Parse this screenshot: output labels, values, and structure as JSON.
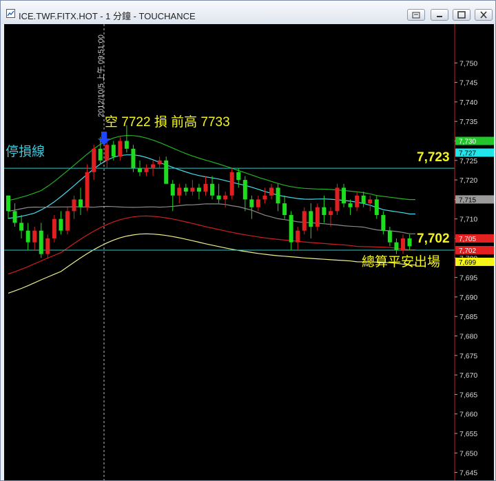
{
  "window": {
    "title": "ICE.TWF.FITX.HOT - 1 分鐘 - TOUCHANCE"
  },
  "chart_data": {
    "type": "candlestick",
    "symbol": "ICE.TWF.FITX.HOT",
    "interval": "1 分鐘",
    "ylim": [
      7642,
      7756
    ],
    "y_ticks": [
      "7,750",
      "7,745",
      "7,740",
      "7,735",
      "7,730",
      "7,725",
      "7,720",
      "7,715",
      "7,710",
      "7,705",
      "7,700",
      "7,695",
      "7,690",
      "7,685",
      "7,680",
      "7,675",
      "7,670",
      "7,665",
      "7,660",
      "7,655",
      "7,650",
      "7,645"
    ],
    "timestamp_label": "2012/10/5 上午 09:51:00",
    "annotations": {
      "entry": "空 7722 損 前高 7733",
      "stop_line_label": "停損線",
      "stop_level_text": "7,723",
      "exit_level_text": "7,702",
      "exit_note": "總算平安出場"
    },
    "reference_lines": [
      7723,
      7702
    ],
    "price_tags": [
      {
        "text": "7,730",
        "value": 7730,
        "bg": "#22c52a",
        "fg": "#ffffff"
      },
      {
        "text": "7,727",
        "value": 7727,
        "bg": "#22e5ea",
        "fg": "#000000"
      },
      {
        "text": "7,715",
        "value": 7715,
        "bg": "#9b9b9b",
        "fg": "#000000"
      },
      {
        "text": "7,705",
        "value": 7705,
        "bg": "#e52020",
        "fg": "#ffffff"
      },
      {
        "text": "7,702",
        "value": 7702,
        "bg": "#e52020",
        "fg": "#ffffff"
      },
      {
        "text": "7,699",
        "value": 7699,
        "bg": "#f5f516",
        "fg": "#000000"
      }
    ],
    "colors": {
      "up": "#e02020",
      "down": "#1edc1e",
      "bb_upper": "#22b422",
      "ma_cyan": "#46dcf0",
      "ma_gray": "#8c8c8c",
      "bb_lower_red": "#d21e1e",
      "bb_lower_yellow": "#f0f08c",
      "ref_line": "#32c8c8",
      "annotation": "#f5f51e",
      "arrow": "#1e46ff",
      "axis_border": "#c81e1e"
    },
    "candles": [
      [
        7716,
        7716,
        7710,
        7712
      ],
      [
        7712,
        7714,
        7708,
        7709
      ],
      [
        7709,
        7711,
        7705,
        7707
      ],
      [
        7707,
        7709,
        7702,
        7704
      ],
      [
        7704,
        7708,
        7702,
        7707
      ],
      [
        7707,
        7709,
        7700,
        7701
      ],
      [
        7701,
        7706,
        7700,
        7705
      ],
      [
        7705,
        7711,
        7704,
        7710
      ],
      [
        7710,
        7712,
        7706,
        7707
      ],
      [
        7707,
        7713,
        7706,
        7712
      ],
      [
        7712,
        7716,
        7710,
        7715
      ],
      [
        7715,
        7718,
        7711,
        7713
      ],
      [
        7713,
        7724,
        7712,
        7722
      ],
      [
        7722,
        7729,
        7720,
        7728
      ],
      [
        7728,
        7731,
        7724,
        7725
      ],
      [
        7725,
        7730,
        7723,
        7729
      ],
      [
        7729,
        7730,
        7725,
        7726
      ],
      [
        7726,
        7731,
        7725,
        7730
      ],
      [
        7730,
        7734,
        7727,
        7728
      ],
      [
        7728,
        7729,
        7722,
        7723
      ],
      [
        7723,
        7725,
        7721,
        7722
      ],
      [
        7722,
        7724,
        7721,
        7723
      ],
      [
        7723,
        7725,
        7721,
        7724
      ],
      [
        7724,
        7726,
        7723,
        7725
      ],
      [
        7725,
        7726,
        7722,
        7719
      ],
      [
        7719,
        7720,
        7712,
        7716
      ],
      [
        7716,
        7719,
        7714,
        7718
      ],
      [
        7718,
        7719,
        7716,
        7717
      ],
      [
        7717,
        7720,
        7716,
        7718
      ],
      [
        7718,
        7719,
        7715,
        7717
      ],
      [
        7717,
        7721,
        7716,
        7719
      ],
      [
        7719,
        7721,
        7715,
        7716
      ],
      [
        7716,
        7719,
        7714,
        7715
      ],
      [
        7715,
        7717,
        7713,
        7716
      ],
      [
        7716,
        7723,
        7715,
        7722
      ],
      [
        7722,
        7723,
        7718,
        7720
      ],
      [
        7720,
        7721,
        7712,
        7715
      ],
      [
        7715,
        7716,
        7710,
        7713
      ],
      [
        7713,
        7716,
        7712,
        7715
      ],
      [
        7715,
        7718,
        7714,
        7716
      ],
      [
        7716,
        7719,
        7715,
        7718
      ],
      [
        7718,
        7719,
        7712,
        7714
      ],
      [
        7714,
        7716,
        7710,
        7711
      ],
      [
        7711,
        7712,
        7702,
        7704
      ],
      [
        7704,
        7708,
        7702,
        7707
      ],
      [
        7707,
        7713,
        7706,
        7712
      ],
      [
        7712,
        7714,
        7705,
        7708
      ],
      [
        7708,
        7714,
        7707,
        7713
      ],
      [
        7713,
        7716,
        7709,
        7711
      ],
      [
        7711,
        7713,
        7708,
        7712
      ],
      [
        7712,
        7719,
        7711,
        7718
      ],
      [
        7718,
        7719,
        7713,
        7714
      ],
      [
        7714,
        7715,
        7711,
        7713
      ],
      [
        7713,
        7717,
        7712,
        7716
      ],
      [
        7716,
        7717,
        7713,
        7714
      ],
      [
        7714,
        7716,
        7712,
        7715
      ],
      [
        7715,
        7716,
        7710,
        7711
      ],
      [
        7711,
        7712,
        7706,
        7707
      ],
      [
        7707,
        7708,
        7703,
        7704
      ],
      [
        7704,
        7705,
        7701,
        7702
      ],
      [
        7702,
        7706,
        7701,
        7705
      ],
      [
        7705,
        7706,
        7702,
        7703
      ]
    ]
  }
}
